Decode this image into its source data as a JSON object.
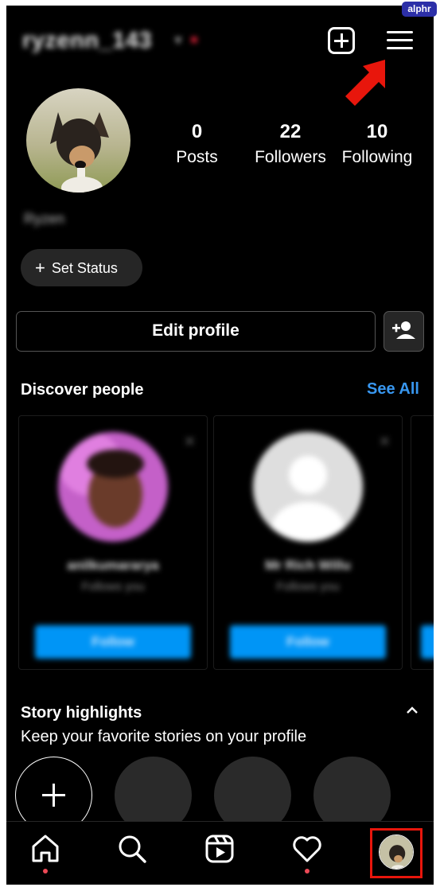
{
  "watermark": "alphr",
  "header": {
    "username": "ryzenn_143"
  },
  "profile": {
    "fullname": "Ryzen",
    "stats": [
      {
        "value": "0",
        "label": "Posts"
      },
      {
        "value": "22",
        "label": "Followers"
      },
      {
        "value": "10",
        "label": "Following"
      }
    ],
    "set_status_label": "Set Status",
    "edit_profile_label": "Edit profile"
  },
  "discover": {
    "title": "Discover people",
    "see_all": "See All",
    "cards": [
      {
        "name": "anilkumararya",
        "subtitle": "Follows you",
        "button": "Follow"
      },
      {
        "name": "Mr Rich Willu",
        "subtitle": "Follows you",
        "button": "Follow"
      }
    ]
  },
  "highlights": {
    "title": "Story highlights",
    "subtitle": "Keep your favorite stories on your profile"
  },
  "colors": {
    "accent": "#3897f0",
    "follow_button": "#0095f6",
    "notification_dot": "#ed4956",
    "annotation_red": "#e8160c"
  }
}
